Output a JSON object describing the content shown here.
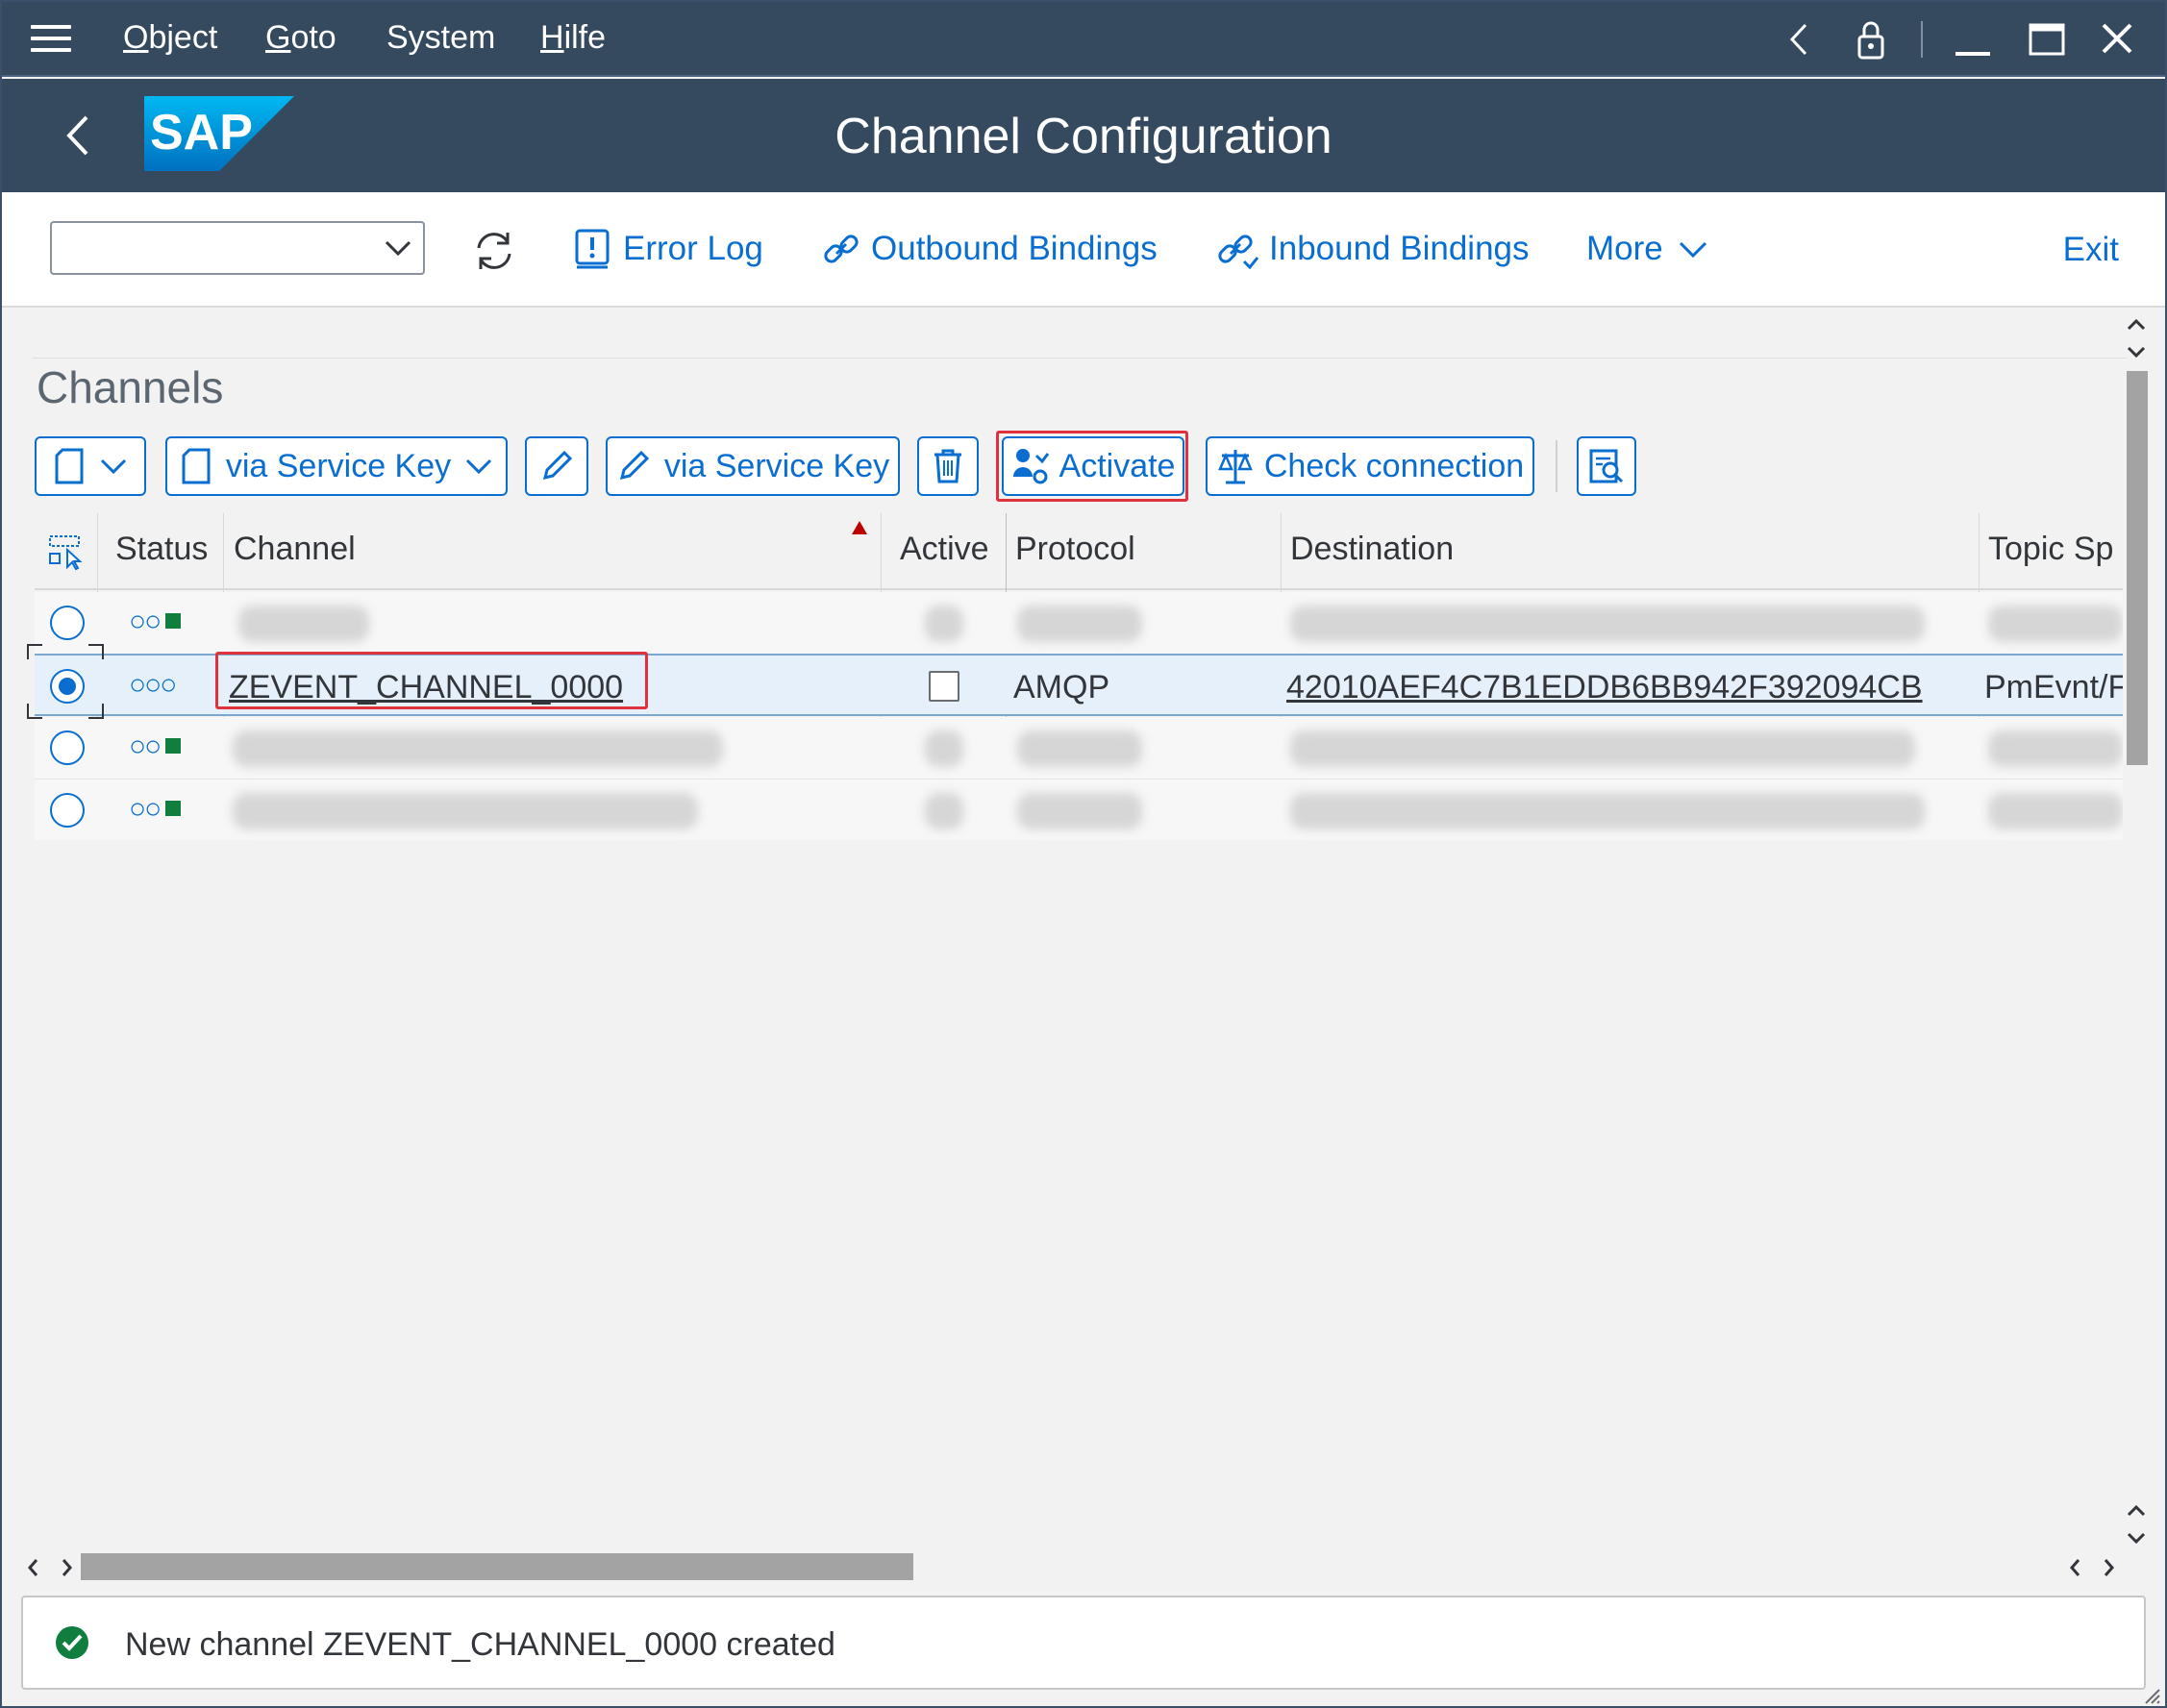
{
  "menu": {
    "items": [
      {
        "underline": "O",
        "rest": "bject"
      },
      {
        "underline": "G",
        "rest": "oto"
      },
      {
        "underline": "",
        "rest": "System"
      },
      {
        "underline": "H",
        "rest": "ilfe"
      }
    ]
  },
  "header": {
    "logo_text": "SAP",
    "title": "Channel Configuration"
  },
  "toolbar": {
    "combo_value": "",
    "error_log": "Error Log",
    "outbound_bindings": "Outbound Bindings",
    "inbound_bindings": "Inbound Bindings",
    "more": "More",
    "exit": "Exit"
  },
  "panel": {
    "title": "Channels",
    "buttons": {
      "create_service_key": "via Service Key",
      "edit_service_key": "via Service Key",
      "activate": "Activate",
      "check_connection": "Check connection"
    }
  },
  "table": {
    "columns": [
      "Status",
      "Channel",
      "Active",
      "Protocol",
      "Destination",
      "Topic Sp"
    ],
    "selected_row": {
      "channel": "ZEVENT_CHANNEL_0000",
      "protocol": "AMQP",
      "destination": "42010AEF4C7B1EDDB6BB942F392094CB",
      "topic_space": "PmEvnt/F"
    }
  },
  "status_message": "New channel ZEVENT_CHANNEL_0000 created",
  "colors": {
    "shell": "#354a5f",
    "accent": "#0a6ed1",
    "highlight": "#e0323c",
    "success": "#107e3e"
  }
}
